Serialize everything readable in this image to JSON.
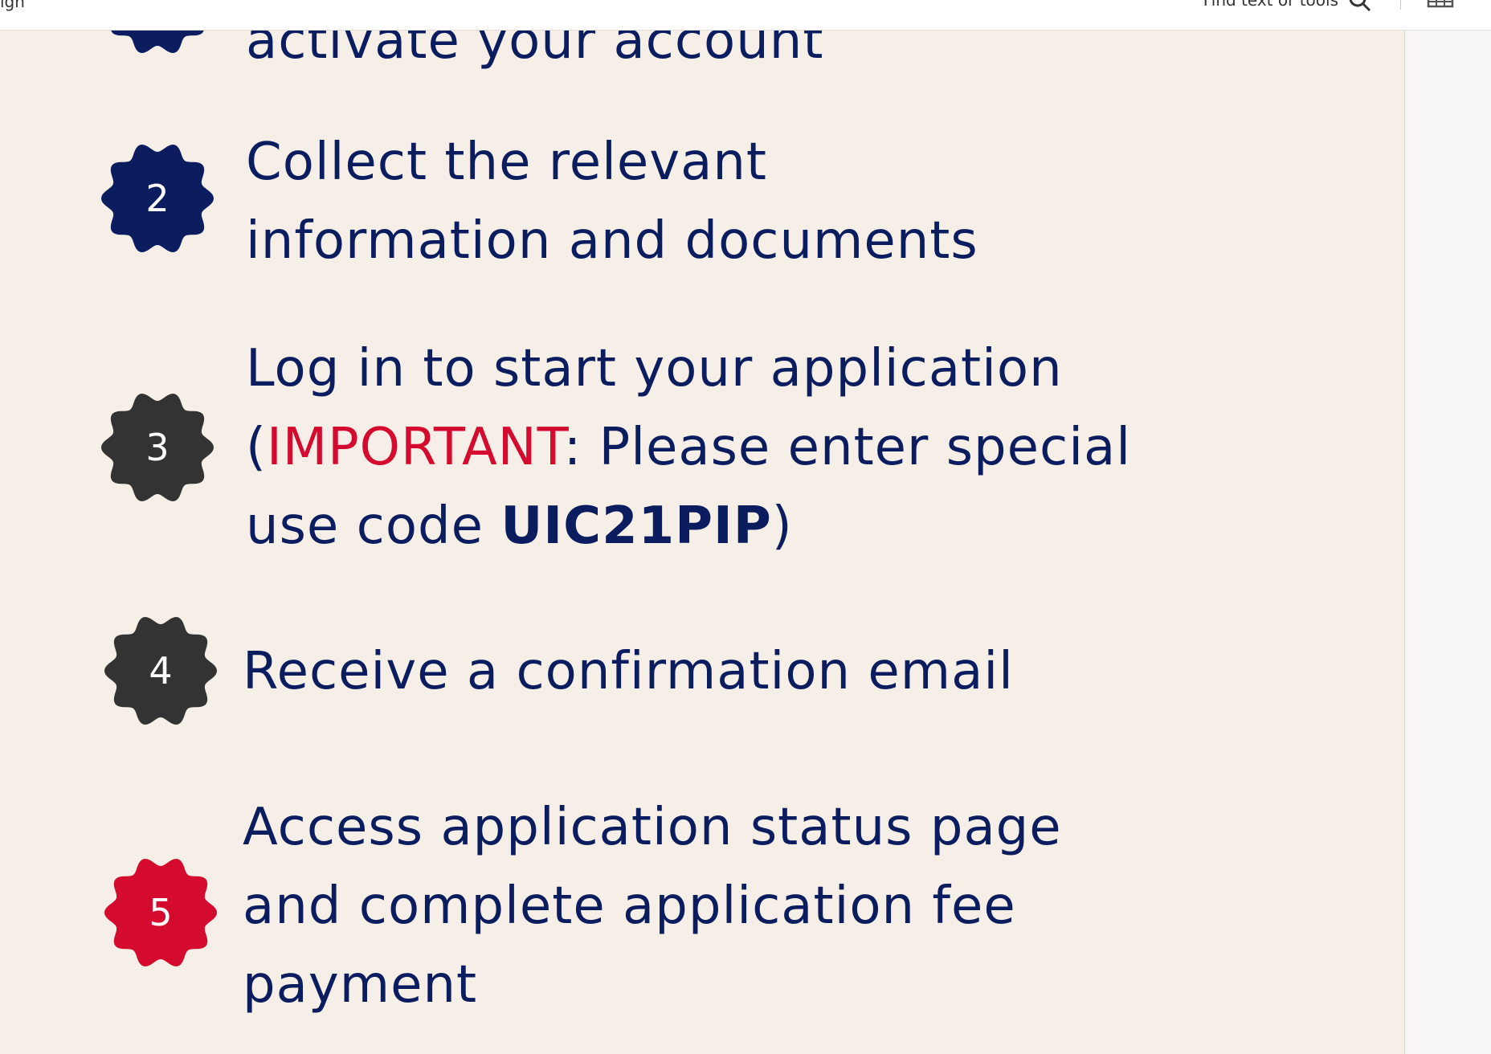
{
  "toolbar": {
    "left_text": "igh",
    "find_label": "Find text or tools",
    "search_icon": "search-icon",
    "panel_icon": "panel-layout-icon"
  },
  "colors": {
    "navy": "#0b1d5e",
    "dark": "#333333",
    "red": "#d40a2e",
    "page_bg": "#f5efe8"
  },
  "steps": [
    {
      "number": "",
      "lines": [
        "activate your account"
      ],
      "badge_color": "navy"
    },
    {
      "number": "2",
      "lines": [
        "Collect the relevant",
        "information and documents"
      ],
      "badge_color": "navy"
    },
    {
      "number": "3",
      "line1": "Log in to start your application",
      "line2_open": "(",
      "line2_important": "IMPORTANT",
      "line2_rest": ": Please enter special",
      "line3_prefix": "use code ",
      "line3_code": "UIC21PIP",
      "line3_close": ")",
      "badge_color": "dark"
    },
    {
      "number": "4",
      "lines": [
        "Receive a confirmation email"
      ],
      "badge_color": "dark"
    },
    {
      "number": "5",
      "lines": [
        "Access application status page",
        "and complete application fee",
        "payment"
      ],
      "badge_color": "red"
    }
  ]
}
